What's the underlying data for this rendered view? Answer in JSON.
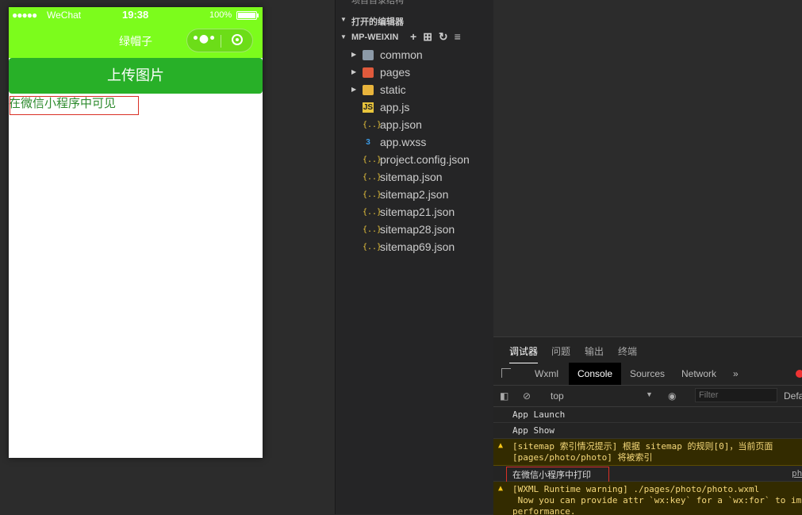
{
  "phone": {
    "status": {
      "signal": "●●●●●",
      "carrier": "WeChat",
      "time": "19:38",
      "battery": "100%",
      "battery_level": 1.0
    },
    "nav_title": "绿帽子",
    "capsule_menu": "•●•",
    "upload_button": "上传图片",
    "visible_text": "在微信小程序中可见",
    "colors": {
      "nav": "#7cfc1c",
      "button": "#28b028",
      "text": "#2e8b2e"
    }
  },
  "explorer": {
    "top_cut": "项目目录结构",
    "open_editors": "打开的编辑器",
    "project": "MP-WEIXIN",
    "tools": [
      "+",
      "⊞",
      "↻",
      "≡"
    ],
    "items": [
      {
        "name": "common",
        "icon": "folder-icon",
        "folder": true
      },
      {
        "name": "pages",
        "icon": "pages-folder-icon",
        "folder": true
      },
      {
        "name": "static",
        "icon": "static-folder-icon",
        "folder": true
      },
      {
        "name": "app.js",
        "icon": "js-icon"
      },
      {
        "name": "app.json",
        "icon": "json-icon"
      },
      {
        "name": "app.wxss",
        "icon": "css-icon"
      },
      {
        "name": "project.config.json",
        "icon": "json-icon"
      },
      {
        "name": "sitemap.json",
        "icon": "json-icon"
      },
      {
        "name": "sitemap2.json",
        "icon": "json-icon"
      },
      {
        "name": "sitemap21.json",
        "icon": "json-icon"
      },
      {
        "name": "sitemap28.json",
        "icon": "json-icon"
      },
      {
        "name": "sitemap69.json",
        "icon": "json-icon"
      }
    ]
  },
  "debugger": {
    "panel_tabs": [
      "调试器",
      "问题",
      "输出",
      "终端"
    ],
    "dev_tabs": [
      "Wxml",
      "Console",
      "Sources",
      "Network"
    ],
    "more": "»",
    "context": "top",
    "filter_placeholder": "Filter",
    "levels": "Default",
    "logs": [
      {
        "type": "info",
        "text": "App Launch"
      },
      {
        "type": "info",
        "text": "App Show"
      },
      {
        "type": "warn",
        "text": "[sitemap 索引情况提示] 根据 sitemap 的规则[0]，当前页面\n[pages/photo/photo] 将被索引"
      },
      {
        "type": "info",
        "text": "在微信小程序中打印",
        "source": "photo"
      },
      {
        "type": "warn",
        "text": "[WXML Runtime warning] ./pages/photo/photo.wxml\n Now you can provide attr `wx:key` for a `wx:for` to improve\nperformance."
      }
    ]
  }
}
